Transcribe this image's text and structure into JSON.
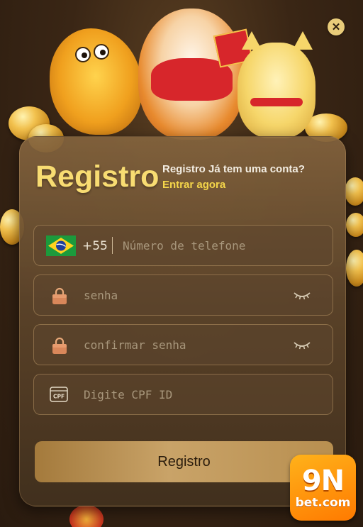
{
  "header": {
    "title": "Registro",
    "login_prompt": "Registro Já tem uma conta?",
    "login_link": "Entrar agora"
  },
  "form": {
    "phone": {
      "country_flag": "brazil-flag-icon",
      "dial_code": "+55",
      "placeholder": "Número de telefone",
      "value": ""
    },
    "password": {
      "placeholder": "senha",
      "value": "",
      "icon": "lock-icon",
      "toggle_icon": "eye-closed-icon"
    },
    "confirm_password": {
      "placeholder": "confirmar senha",
      "value": "",
      "icon": "lock-icon",
      "toggle_icon": "eye-closed-icon"
    },
    "cpf": {
      "placeholder": "Digite CPF ID",
      "value": "",
      "icon": "cpf-card-icon",
      "icon_text": "CPF"
    },
    "submit_label": "Registro"
  },
  "brand": {
    "line1": "9N",
    "line2": "bet.com"
  },
  "colors": {
    "title": "#f8dc72",
    "link": "#f5d64a",
    "brand": "#ff8c00"
  }
}
